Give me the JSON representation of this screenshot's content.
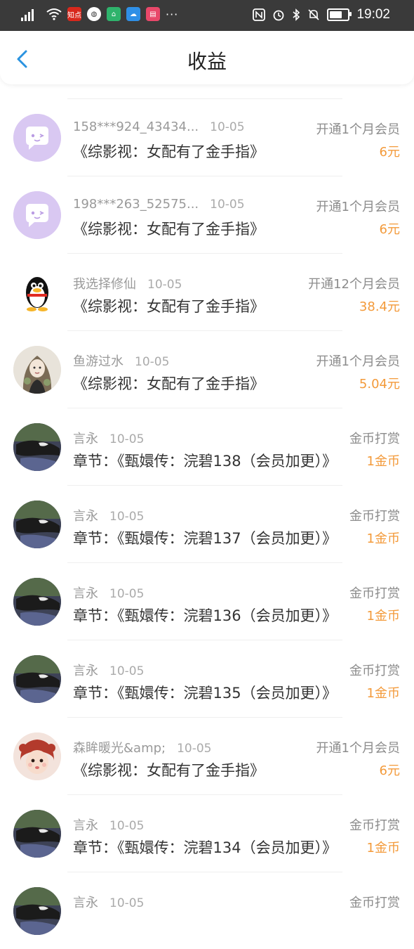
{
  "status_bar": {
    "network": "4G",
    "app_badge": "知点",
    "time": "19:02",
    "battery_level": 0.7
  },
  "header": {
    "title": "收益"
  },
  "records": [
    {
      "avatar": "chat-bubble-avatar",
      "name": "158***924_43434...",
      "date": "10-05",
      "desc": "《综影视：女配有了金手指》",
      "type": "开通1个月会员",
      "amount": "6元"
    },
    {
      "avatar": "chat-bubble-avatar",
      "name": "198***263_52575...",
      "date": "10-05",
      "desc": "《综影视：女配有了金手指》",
      "type": "开通1个月会员",
      "amount": "6元"
    },
    {
      "avatar": "penguin-avatar",
      "name": "我选择修仙",
      "date": "10-05",
      "desc": "《综影视：女配有了金手指》",
      "type": "开通12个月会员",
      "amount": "38.4元"
    },
    {
      "avatar": "girl-avatar",
      "name": "鱼游过水",
      "date": "10-05",
      "desc": "《综影视：女配有了金手指》",
      "type": "开通1个月会员",
      "amount": "5.04元"
    },
    {
      "avatar": "cat-avatar",
      "name": "言永",
      "date": "10-05",
      "desc": "章节：《甄嬛传：浣碧138（会员加更）》",
      "type": "金币打赏",
      "amount": "1金币"
    },
    {
      "avatar": "cat-avatar",
      "name": "言永",
      "date": "10-05",
      "desc": "章节：《甄嬛传：浣碧137（会员加更）》",
      "type": "金币打赏",
      "amount": "1金币"
    },
    {
      "avatar": "cat-avatar",
      "name": "言永",
      "date": "10-05",
      "desc": "章节：《甄嬛传：浣碧136（会员加更）》",
      "type": "金币打赏",
      "amount": "1金币"
    },
    {
      "avatar": "cat-avatar",
      "name": "言永",
      "date": "10-05",
      "desc": "章节：《甄嬛传：浣碧135（会员加更）》",
      "type": "金币打赏",
      "amount": "1金币"
    },
    {
      "avatar": "baby-avatar",
      "name": "森眸暖光&amp;",
      "date": "10-05",
      "desc": "《综影视：女配有了金手指》",
      "type": "开通1个月会员",
      "amount": "6元"
    },
    {
      "avatar": "cat-avatar",
      "name": "言永",
      "date": "10-05",
      "desc": "章节：《甄嬛传：浣碧134（会员加更）》",
      "type": "金币打赏",
      "amount": "1金币"
    },
    {
      "avatar": "cat-avatar",
      "name": "言永",
      "date": "10-05",
      "desc": "",
      "type": "金币打赏",
      "amount": ""
    }
  ],
  "colors": {
    "accent": "#2a93e0",
    "amount": "#f39a3a",
    "status_bar": "#3a3a3a"
  }
}
